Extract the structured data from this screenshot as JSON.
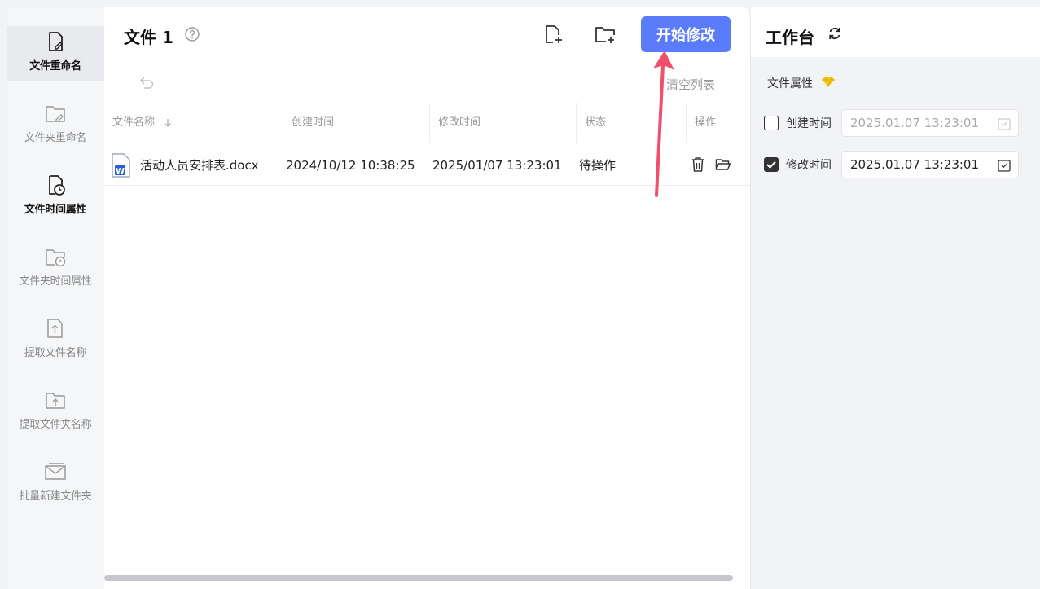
{
  "sidebar": {
    "items": [
      {
        "label": "文件重命名"
      },
      {
        "label": "文件夹重命名"
      },
      {
        "label": "文件时间属性"
      },
      {
        "label": "文件夹时间属性"
      },
      {
        "label": "提取文件名称"
      },
      {
        "label": "提取文件夹名称"
      },
      {
        "label": "批量新建文件夹"
      }
    ]
  },
  "main": {
    "title": "文件 1",
    "start_button": "开始修改",
    "clear_list": "清空列表",
    "columns": [
      "文件名称",
      "创建时间",
      "修改时间",
      "状态",
      "操作"
    ],
    "rows": [
      {
        "name": "活动人员安排表.docx",
        "created": "2024/10/12 10:38:25",
        "modified": "2025/01/07 13:23:01",
        "status": "待操作"
      }
    ]
  },
  "workbench": {
    "title": "工作台",
    "section_label": "文件属性",
    "create_time": {
      "label": "创建时间",
      "value": "2025.01.07 13:23:01",
      "checked": false
    },
    "modify_time": {
      "label": "修改时间",
      "value": "2025.01.07 13:23:01",
      "checked": true
    }
  },
  "colors": {
    "accent": "#5b7cfa",
    "arrow": "#f0506e",
    "gem": "#f5c518",
    "word_blue": "#2b5fd9"
  }
}
